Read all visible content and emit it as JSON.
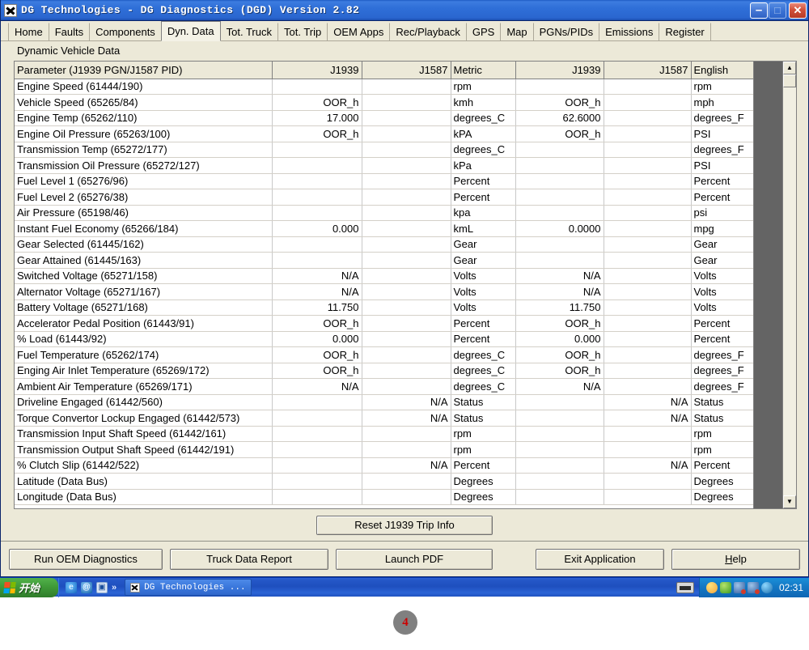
{
  "window": {
    "title": "DG Technologies - DG Diagnostics (DGD) Version 2.82",
    "icon": "dg-logo-icon",
    "minimize_label": "–",
    "maximize_label": "□",
    "close_label": "✕"
  },
  "tabs": [
    {
      "label": "Home",
      "active": false
    },
    {
      "label": "Faults",
      "active": false
    },
    {
      "label": "Components",
      "active": false
    },
    {
      "label": "Dyn. Data",
      "active": true
    },
    {
      "label": "Tot. Truck",
      "active": false
    },
    {
      "label": "Tot. Trip",
      "active": false
    },
    {
      "label": "OEM Apps",
      "active": false
    },
    {
      "label": "Rec/Playback",
      "active": false
    },
    {
      "label": "GPS",
      "active": false
    },
    {
      "label": "Map",
      "active": false
    },
    {
      "label": "PGNs/PIDs",
      "active": false
    },
    {
      "label": "Emissions",
      "active": false
    },
    {
      "label": "Register",
      "active": false
    }
  ],
  "subtitle": "Dynamic Vehicle Data",
  "table": {
    "columns": [
      "Parameter (J1939 PGN/J1587 PID)",
      "J1939",
      "J1587",
      "Metric",
      "J1939",
      "J1587",
      "English"
    ],
    "rows": [
      [
        "Engine Speed (61444/190)",
        "",
        "",
        "rpm",
        "",
        "",
        "rpm"
      ],
      [
        "Vehicle Speed (65265/84)",
        "OOR_h",
        "",
        "kmh",
        "OOR_h",
        "",
        "mph"
      ],
      [
        "Engine Temp (65262/110)",
        "17.000",
        "",
        "degrees_C",
        "62.6000",
        "",
        "degrees_F"
      ],
      [
        "Engine Oil Pressure (65263/100)",
        "OOR_h",
        "",
        "kPA",
        "OOR_h",
        "",
        "PSI"
      ],
      [
        "Transmission Temp (65272/177)",
        "",
        "",
        "degrees_C",
        "",
        "",
        "degrees_F"
      ],
      [
        "Transmission Oil Pressure (65272/127)",
        "",
        "",
        "kPa",
        "",
        "",
        "PSI"
      ],
      [
        "Fuel Level 1 (65276/96)",
        "",
        "",
        "Percent",
        "",
        "",
        "Percent"
      ],
      [
        "Fuel Level 2 (65276/38)",
        "",
        "",
        "Percent",
        "",
        "",
        "Percent"
      ],
      [
        "Air Pressure (65198/46)",
        "",
        "",
        "kpa",
        "",
        "",
        "psi"
      ],
      [
        "Instant Fuel Economy (65266/184)",
        "0.000",
        "",
        "kmL",
        "0.0000",
        "",
        "mpg"
      ],
      [
        "Gear Selected (61445/162)",
        "",
        "",
        "Gear",
        "",
        "",
        "Gear"
      ],
      [
        "Gear Attained (61445/163)",
        "",
        "",
        "Gear",
        "",
        "",
        "Gear"
      ],
      [
        "Switched Voltage (65271/158)",
        "N/A",
        "",
        "Volts",
        "N/A",
        "",
        "Volts"
      ],
      [
        "Alternator Voltage (65271/167)",
        "N/A",
        "",
        "Volts",
        "N/A",
        "",
        "Volts"
      ],
      [
        "Battery Voltage (65271/168)",
        "11.750",
        "",
        "Volts",
        "11.750",
        "",
        "Volts"
      ],
      [
        "Accelerator Pedal Position (61443/91)",
        "OOR_h",
        "",
        "Percent",
        "OOR_h",
        "",
        "Percent"
      ],
      [
        "% Load (61443/92)",
        "0.000",
        "",
        "Percent",
        "0.000",
        "",
        "Percent"
      ],
      [
        "Fuel Temperature (65262/174)",
        "OOR_h",
        "",
        "degrees_C",
        "OOR_h",
        "",
        "degrees_F"
      ],
      [
        "Enging Air Inlet Temperature (65269/172)",
        "OOR_h",
        "",
        "degrees_C",
        "OOR_h",
        "",
        "degrees_F"
      ],
      [
        "Ambient Air Temperature (65269/171)",
        "N/A",
        "",
        "degrees_C",
        "N/A",
        "",
        "degrees_F"
      ],
      [
        "Driveline Engaged (61442/560)",
        "",
        "N/A",
        "Status",
        "",
        "N/A",
        "Status"
      ],
      [
        "Torque Convertor Lockup Engaged (61442/573)",
        "",
        "N/A",
        "Status",
        "",
        "N/A",
        "Status"
      ],
      [
        "Transmission Input Shaft Speed (61442/161)",
        "",
        "",
        "rpm",
        "",
        "",
        "rpm"
      ],
      [
        "Transmission Output Shaft Speed (61442/191)",
        "",
        "",
        "rpm",
        "",
        "",
        "rpm"
      ],
      [
        "% Clutch Slip (61442/522)",
        "",
        "N/A",
        "Percent",
        "",
        "N/A",
        "Percent"
      ],
      [
        "Latitude (Data Bus)",
        "",
        "",
        "Degrees",
        "",
        "",
        "Degrees"
      ],
      [
        "Longitude (Data Bus)",
        "",
        "",
        "Degrees",
        "",
        "",
        "Degrees"
      ]
    ]
  },
  "scrollbar": {
    "up_arrow": "▲",
    "down_arrow": "▼"
  },
  "buttons": {
    "reset_trip": "Reset J1939 Trip Info",
    "run_oem": "Run OEM Diagnostics",
    "truck_report": "Truck Data Report",
    "launch_pdf": "Launch PDF",
    "exit_app": "Exit Application",
    "help_accel": "H",
    "help_rest": "elp"
  },
  "taskbar": {
    "start_label": "开始",
    "quicklaunch": [
      "ie-icon",
      "outlook-icon",
      "show-desktop-icon"
    ],
    "quicklaunch_more": "»",
    "task_button": "DG Technologies ...",
    "clock": "02:31"
  },
  "page_marker": "4"
}
